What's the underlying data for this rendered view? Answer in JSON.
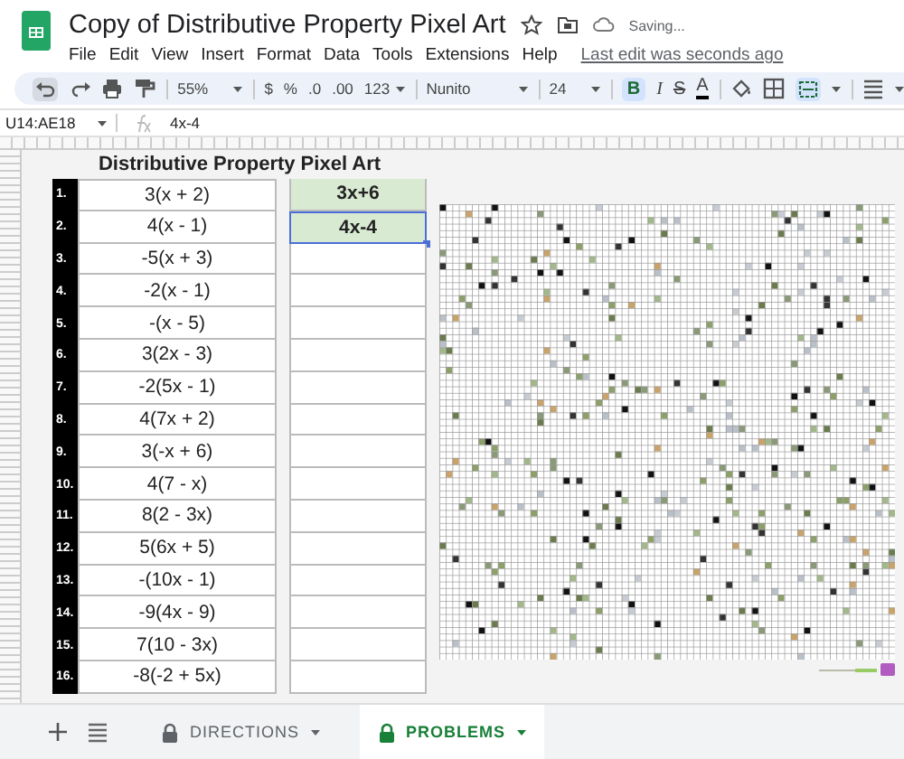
{
  "header": {
    "title": "Copy of Distributive Property Pixel Art",
    "status": "Saving...",
    "menu": [
      "File",
      "Edit",
      "View",
      "Insert",
      "Format",
      "Data",
      "Tools",
      "Extensions",
      "Help"
    ],
    "last_edit": "Last edit was seconds ago"
  },
  "toolbar": {
    "zoom": "55%",
    "currency": "$",
    "percent": "%",
    "decrease_decimals": ".0",
    "increase_decimals": ".00",
    "number_format": "123",
    "font": "Nunito",
    "font_size": "24",
    "bold": "B",
    "italic": "I",
    "strikethrough": "S",
    "text_color": "A"
  },
  "formula_bar": {
    "cell_ref": "U14:AE18",
    "formula": "4x-4"
  },
  "sheet": {
    "heading": "Distributive Property Pixel Art",
    "problems": [
      {
        "number": "1.",
        "expression": "3(x + 2)",
        "answer": "3x+6",
        "selected": false
      },
      {
        "number": "2.",
        "expression": "4(x - 1)",
        "answer": "4x-4",
        "selected": true
      },
      {
        "number": "3.",
        "expression": "-5(x + 3)",
        "selected": false
      },
      {
        "number": "4.",
        "expression": "-2(x - 1)",
        "selected": false
      },
      {
        "number": "5.",
        "expression": "-(x - 5)",
        "selected": false
      },
      {
        "number": "6.",
        "expression": "3(2x - 3)",
        "selected": false
      },
      {
        "number": "7.",
        "expression": "-2(5x - 1)",
        "selected": false
      },
      {
        "number": "8.",
        "expression": "4(7x + 2)",
        "selected": false
      },
      {
        "number": "9.",
        "expression": "3(-x + 6)",
        "selected": false
      },
      {
        "number": "10.",
        "expression": "4(7 - x)",
        "selected": false
      },
      {
        "number": "11.",
        "expression": "8(2 - 3x)",
        "selected": false
      },
      {
        "number": "12.",
        "expression": "5(6x + 5)",
        "selected": false
      },
      {
        "number": "13.",
        "expression": "-(10x - 1)",
        "selected": false
      },
      {
        "number": "14.",
        "expression": "-9(4x - 9)",
        "selected": false
      },
      {
        "number": "15.",
        "expression": "7(10 - 3x)",
        "selected": false
      },
      {
        "number": "16.",
        "expression": "-8(-2 + 5x)",
        "selected": false
      }
    ]
  },
  "sheet_tabs": [
    {
      "label": "DIRECTIONS",
      "selected": false
    },
    {
      "label": "PROBLEMS",
      "selected": true
    }
  ]
}
